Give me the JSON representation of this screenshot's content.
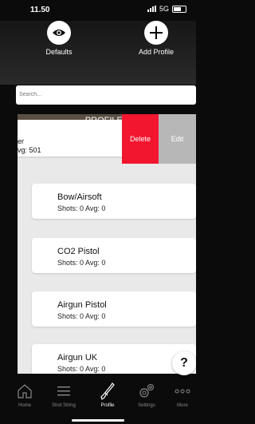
{
  "status": {
    "time": "11.50",
    "network": "5G"
  },
  "hero": {
    "defaults_label": "Defaults",
    "add_profile_label": "Add Profile"
  },
  "search": {
    "placeholder": "Search..."
  },
  "panel": {
    "header": "PROFILES"
  },
  "swiped_row": {
    "line1": "er",
    "line2": "vg: 501",
    "delete_label": "Delete",
    "edit_label": "Edit"
  },
  "profiles": [
    {
      "name": "Bow/Airsoft",
      "stats": "Shots: 0 Avg: 0"
    },
    {
      "name": "CO2 Pistol",
      "stats": "Shots: 0 Avg: 0"
    },
    {
      "name": "Airgun Pistol",
      "stats": "Shots: 0 Avg: 0"
    },
    {
      "name": "Airgun UK",
      "stats": "Shots: 0 Avg: 0"
    }
  ],
  "help": {
    "label": "?"
  },
  "tabs": [
    {
      "label": "Home",
      "icon": "home-icon"
    },
    {
      "label": "Shot String",
      "icon": "list-icon"
    },
    {
      "label": "Profile",
      "icon": "rifle-icon"
    },
    {
      "label": "Settings",
      "icon": "gear-icon"
    },
    {
      "label": "More",
      "icon": "more-icon"
    }
  ],
  "colors": {
    "delete": "#f2162f",
    "edit": "#b7b7b7",
    "header": "#5a4f43"
  }
}
